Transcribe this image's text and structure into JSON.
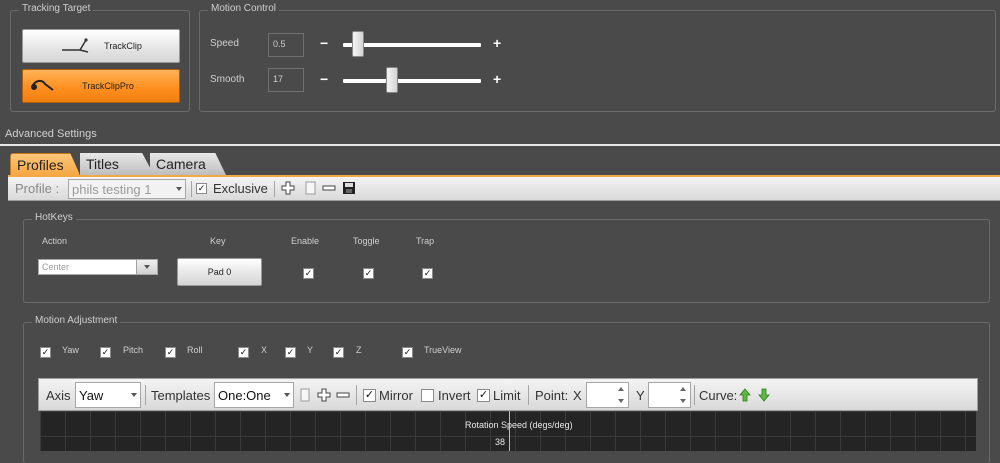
{
  "tracking_target": {
    "title": "Tracking Target",
    "trackclip_label": "TrackClip",
    "trackclippro_label": "TrackClipPro"
  },
  "motion_control": {
    "title": "Motion Control",
    "speed_label": "Speed",
    "speed_value": "0.5",
    "smooth_label": "Smooth",
    "smooth_value": "17",
    "minus": "−",
    "plus": "+"
  },
  "advanced_settings": {
    "title": "Advanced Settings"
  },
  "tabs": [
    {
      "label": "Profiles"
    },
    {
      "label": "Titles"
    },
    {
      "label": "Camera"
    }
  ],
  "profile_bar": {
    "label": "Profile :",
    "value": "phils testing 1",
    "exclusive_label": "Exclusive",
    "exclusive_checked": "✓"
  },
  "hotkeys": {
    "title": "HotKeys",
    "col_action": "Action",
    "col_key": "Key",
    "col_enable": "Enable",
    "col_toggle": "Toggle",
    "col_trap": "Trap",
    "action_value": "Center",
    "key_value": "Pad 0",
    "check": "✓"
  },
  "motion_adjustment": {
    "title": "Motion Adjustment",
    "axes": [
      {
        "label": "Yaw"
      },
      {
        "label": "Pitch"
      },
      {
        "label": "Roll"
      },
      {
        "label": "X"
      },
      {
        "label": "Y"
      },
      {
        "label": "Z"
      },
      {
        "label": "TrueView"
      }
    ],
    "check": "✓"
  },
  "curve_toolbar": {
    "axis_label": "Axis",
    "axis_value": "Yaw",
    "templates_label": "Templates",
    "templates_value": "One:One",
    "mirror_label": "Mirror",
    "invert_label": "Invert",
    "limit_label": "Limit",
    "point_label": "Point:",
    "x_label": "X",
    "y_label": "Y",
    "curve_label": "Curve:",
    "check": "✓"
  },
  "graph": {
    "title": "Rotation Speed (degs/deg)",
    "tick_label": "38"
  },
  "colors": {
    "background": "#4a4a4a",
    "accent_orange": "#ff9020",
    "tab_active": "#f5a742",
    "graph_bg": "#242424"
  }
}
